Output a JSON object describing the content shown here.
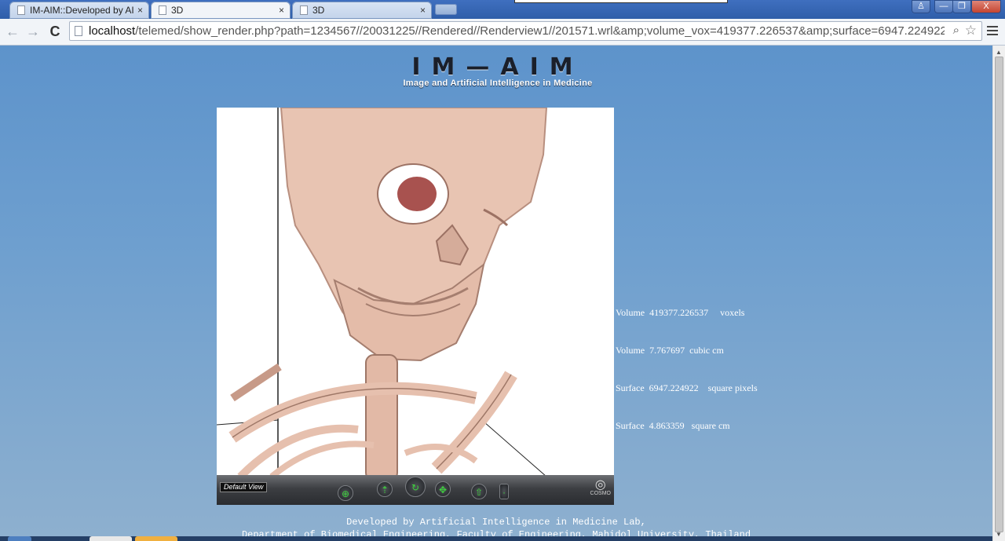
{
  "browser": {
    "tabs": [
      {
        "title": "IM-AIM::Developed by AI"
      },
      {
        "title": "3D"
      },
      {
        "title": "3D"
      }
    ],
    "close_glyph": "×",
    "url_host": "localhost",
    "url_rest": "/telemed/show_render.php?path=1234567//20031225//Rendered//Renderview1//201571.wrl&amp;volume_vox=419377.226537&amp;surface=6947.224922",
    "window_controls": {
      "profile": "♙",
      "minimize": "—",
      "restore": "❐",
      "close": "X"
    }
  },
  "icons": {
    "back": "back-arrow-icon",
    "forward": "forward-arrow-icon",
    "reload": "reload-icon",
    "search": "magnifier-icon",
    "bookmark": "star-icon",
    "menu": "hamburger-menu-icon"
  },
  "logo": {
    "wordmark": "IM—AIM",
    "tagline": "Image and Artificial Intelligence in Medicine"
  },
  "viewer": {
    "default_view_label": "Default View",
    "brand": "COSMO"
  },
  "stats": {
    "rows": [
      {
        "label": "Volume",
        "value": "419377.226537",
        "unit": "voxels"
      },
      {
        "label": "Volume",
        "value": "7.767697",
        "unit": "cubic cm"
      },
      {
        "label": "Surface",
        "value": "6947.224922",
        "unit": "square pixels"
      },
      {
        "label": "Surface",
        "value": "4.863359",
        "unit": "square cm"
      }
    ]
  },
  "footer": {
    "line1": "Developed by Artificial Intelligence in Medicine Lab,",
    "line2": "Department of Biomedical Engineering, Faculty of Engineering, Mahidol University, Thailand"
  },
  "colors": {
    "page_bg": "#6e9fcf",
    "bone": "#e8c4b2",
    "control_bar": "#3c3e42",
    "control_accent": "#3ed13e"
  }
}
